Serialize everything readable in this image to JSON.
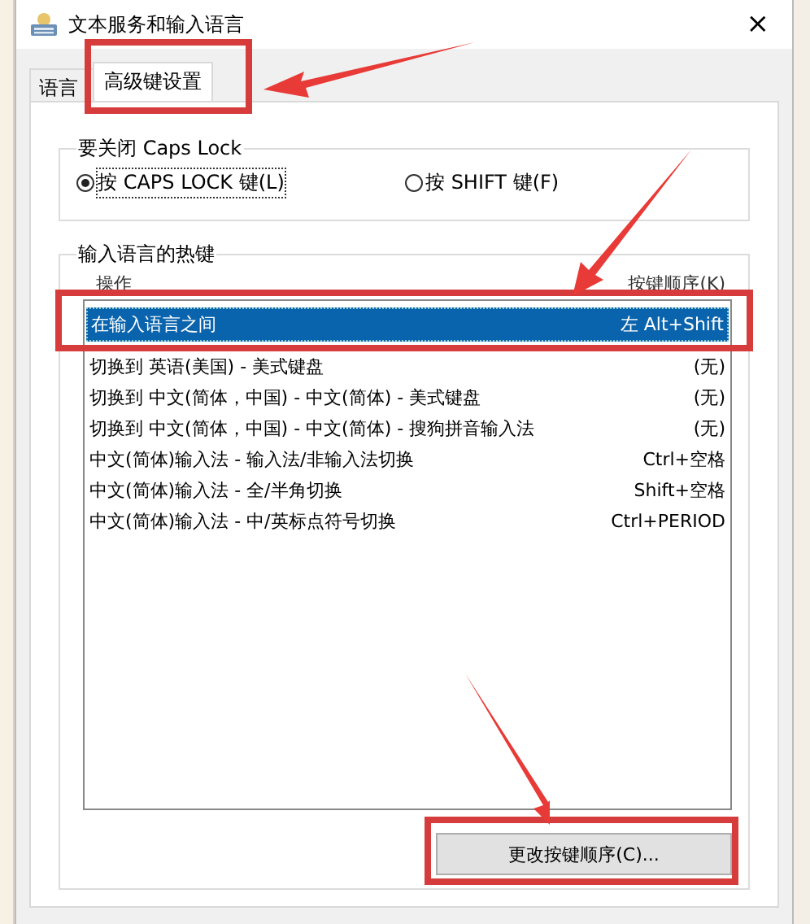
{
  "window": {
    "title": "文本服务和输入语言",
    "close": "×"
  },
  "tabs": [
    {
      "label": "语言",
      "selected": false
    },
    {
      "label": "高级键设置",
      "selected": true
    }
  ],
  "caps_lock_group": {
    "title": "要关闭 Caps Lock",
    "options": [
      {
        "label": "按 CAPS LOCK 键(L)",
        "selected": true
      },
      {
        "label": "按 SHIFT 键(F)",
        "selected": false
      }
    ]
  },
  "hotkeys_group": {
    "title": "输入语言的热键",
    "columns": [
      "操作",
      "按键顺序(K)"
    ],
    "rows": [
      {
        "action": "在输入语言之间",
        "keys": "左 Alt+Shift",
        "selected": true
      },
      {
        "action": "切换到 英语(美国) - 美式键盘",
        "keys": "(无)",
        "selected": false
      },
      {
        "action": "切换到 中文(简体，中国) - 中文(简体) - 美式键盘",
        "keys": "(无)",
        "selected": false
      },
      {
        "action": "切换到 中文(简体，中国) - 中文(简体) - 搜狗拼音输入法",
        "keys": "(无)",
        "selected": false
      },
      {
        "action": "中文(简体)输入法 - 输入法/非输入法切换",
        "keys": "Ctrl+空格",
        "selected": false
      },
      {
        "action": "中文(简体)输入法 - 全/半角切换",
        "keys": "Shift+空格",
        "selected": false
      },
      {
        "action": "中文(简体)输入法 - 中/英标点符号切换",
        "keys": "Ctrl+PERIOD",
        "selected": false
      }
    ],
    "button": "更改按键顺序(C)..."
  }
}
